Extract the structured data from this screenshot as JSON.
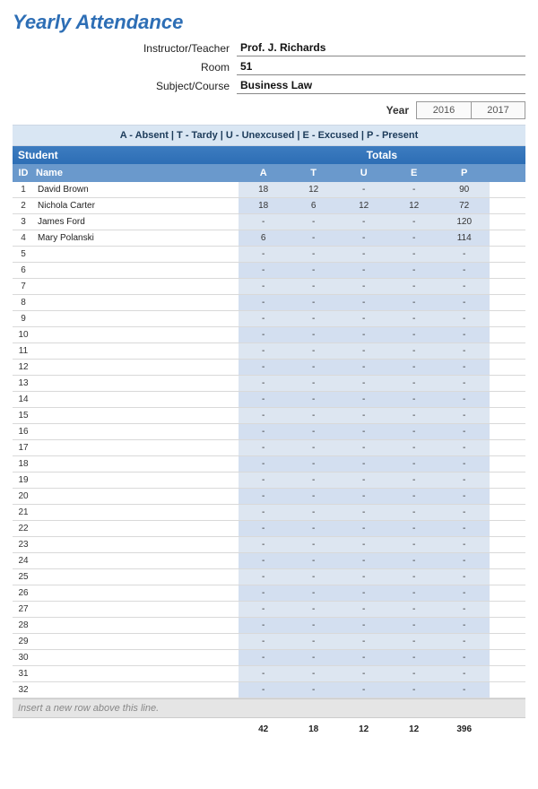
{
  "title": "Yearly Attendance",
  "header": {
    "instructor_label": "Instructor/Teacher",
    "instructor_value": "Prof. J. Richards",
    "room_label": "Room",
    "room_value": "51",
    "subject_label": "Subject/Course",
    "subject_value": "Business Law"
  },
  "year_label": "Year",
  "year_tabs": [
    "2016",
    "2017"
  ],
  "legend": "A - Absent  |  T - Tardy  |  U - Unexcused  |  E - Excused  |  P - Present",
  "band": {
    "student": "Student",
    "totals": "Totals"
  },
  "columns": {
    "id": "ID",
    "name": "Name",
    "a": "A",
    "t": "T",
    "u": "U",
    "e": "E",
    "p": "P"
  },
  "rows": [
    {
      "id": "1",
      "name": "David Brown",
      "a": "18",
      "t": "12",
      "u": "-",
      "e": "-",
      "p": "90"
    },
    {
      "id": "2",
      "name": "Nichola Carter",
      "a": "18",
      "t": "6",
      "u": "12",
      "e": "12",
      "p": "72"
    },
    {
      "id": "3",
      "name": "James Ford",
      "a": "-",
      "t": "-",
      "u": "-",
      "e": "-",
      "p": "120"
    },
    {
      "id": "4",
      "name": "Mary Polanski",
      "a": "6",
      "t": "-",
      "u": "-",
      "e": "-",
      "p": "114"
    },
    {
      "id": "5",
      "name": "",
      "a": "-",
      "t": "-",
      "u": "-",
      "e": "-",
      "p": "-"
    },
    {
      "id": "6",
      "name": "",
      "a": "-",
      "t": "-",
      "u": "-",
      "e": "-",
      "p": "-"
    },
    {
      "id": "7",
      "name": "",
      "a": "-",
      "t": "-",
      "u": "-",
      "e": "-",
      "p": "-"
    },
    {
      "id": "8",
      "name": "",
      "a": "-",
      "t": "-",
      "u": "-",
      "e": "-",
      "p": "-"
    },
    {
      "id": "9",
      "name": "",
      "a": "-",
      "t": "-",
      "u": "-",
      "e": "-",
      "p": "-"
    },
    {
      "id": "10",
      "name": "",
      "a": "-",
      "t": "-",
      "u": "-",
      "e": "-",
      "p": "-"
    },
    {
      "id": "11",
      "name": "",
      "a": "-",
      "t": "-",
      "u": "-",
      "e": "-",
      "p": "-"
    },
    {
      "id": "12",
      "name": "",
      "a": "-",
      "t": "-",
      "u": "-",
      "e": "-",
      "p": "-"
    },
    {
      "id": "13",
      "name": "",
      "a": "-",
      "t": "-",
      "u": "-",
      "e": "-",
      "p": "-"
    },
    {
      "id": "14",
      "name": "",
      "a": "-",
      "t": "-",
      "u": "-",
      "e": "-",
      "p": "-"
    },
    {
      "id": "15",
      "name": "",
      "a": "-",
      "t": "-",
      "u": "-",
      "e": "-",
      "p": "-"
    },
    {
      "id": "16",
      "name": "",
      "a": "-",
      "t": "-",
      "u": "-",
      "e": "-",
      "p": "-"
    },
    {
      "id": "17",
      "name": "",
      "a": "-",
      "t": "-",
      "u": "-",
      "e": "-",
      "p": "-"
    },
    {
      "id": "18",
      "name": "",
      "a": "-",
      "t": "-",
      "u": "-",
      "e": "-",
      "p": "-"
    },
    {
      "id": "19",
      "name": "",
      "a": "-",
      "t": "-",
      "u": "-",
      "e": "-",
      "p": "-"
    },
    {
      "id": "20",
      "name": "",
      "a": "-",
      "t": "-",
      "u": "-",
      "e": "-",
      "p": "-"
    },
    {
      "id": "21",
      "name": "",
      "a": "-",
      "t": "-",
      "u": "-",
      "e": "-",
      "p": "-"
    },
    {
      "id": "22",
      "name": "",
      "a": "-",
      "t": "-",
      "u": "-",
      "e": "-",
      "p": "-"
    },
    {
      "id": "23",
      "name": "",
      "a": "-",
      "t": "-",
      "u": "-",
      "e": "-",
      "p": "-"
    },
    {
      "id": "24",
      "name": "",
      "a": "-",
      "t": "-",
      "u": "-",
      "e": "-",
      "p": "-"
    },
    {
      "id": "25",
      "name": "",
      "a": "-",
      "t": "-",
      "u": "-",
      "e": "-",
      "p": "-"
    },
    {
      "id": "26",
      "name": "",
      "a": "-",
      "t": "-",
      "u": "-",
      "e": "-",
      "p": "-"
    },
    {
      "id": "27",
      "name": "",
      "a": "-",
      "t": "-",
      "u": "-",
      "e": "-",
      "p": "-"
    },
    {
      "id": "28",
      "name": "",
      "a": "-",
      "t": "-",
      "u": "-",
      "e": "-",
      "p": "-"
    },
    {
      "id": "29",
      "name": "",
      "a": "-",
      "t": "-",
      "u": "-",
      "e": "-",
      "p": "-"
    },
    {
      "id": "30",
      "name": "",
      "a": "-",
      "t": "-",
      "u": "-",
      "e": "-",
      "p": "-"
    },
    {
      "id": "31",
      "name": "",
      "a": "-",
      "t": "-",
      "u": "-",
      "e": "-",
      "p": "-"
    },
    {
      "id": "32",
      "name": "",
      "a": "-",
      "t": "-",
      "u": "-",
      "e": "-",
      "p": "-"
    }
  ],
  "insert_hint": "Insert a new row above this line.",
  "footer_totals": {
    "a": "42",
    "t": "18",
    "u": "12",
    "e": "12",
    "p": "396"
  }
}
